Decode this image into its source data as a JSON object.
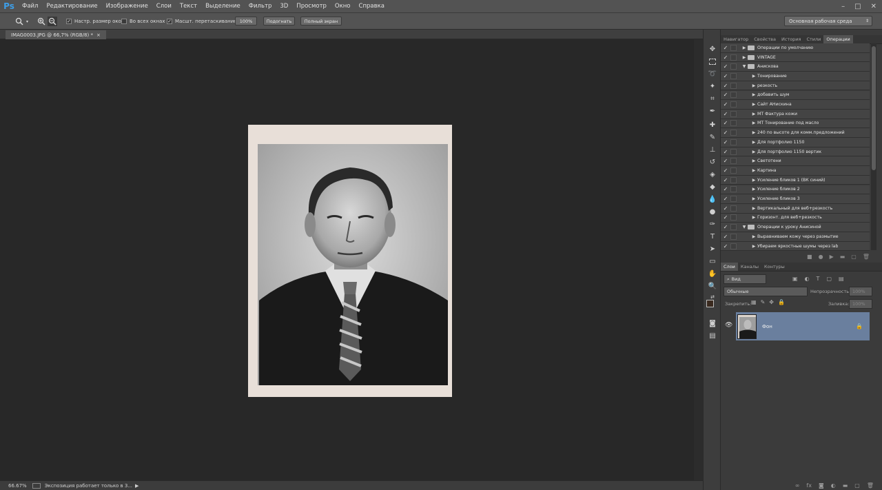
{
  "menubar": {
    "logo": "Ps",
    "items": [
      "Файл",
      "Редактирование",
      "Изображение",
      "Слои",
      "Текст",
      "Выделение",
      "Фильтр",
      "3D",
      "Просмотр",
      "Окно",
      "Справка"
    ],
    "window_controls": [
      "–",
      "□",
      "✕"
    ]
  },
  "optionsbar": {
    "resize_windows": "Настр. размер окон",
    "all_windows": "Во всех окнах",
    "scrubby_zoom": "Масшт. перетаскиванием",
    "btn_100": "100%",
    "btn_fit": "Подогнать",
    "btn_fullscreen": "Полный экран",
    "workspace": "Основная рабочая среда"
  },
  "document": {
    "tab_title": "IMAG0003.JPG @ 66,7% (RGB/8) *",
    "tab_close": "×"
  },
  "statusbar": {
    "zoom": "66.67%",
    "message": "Экспозиция работает только в 3..."
  },
  "panels": {
    "top_tabs": [
      "Навигатор",
      "Свойства",
      "История",
      "Стили",
      "Операции"
    ],
    "actions": [
      {
        "label": "Операции по умолчанию",
        "folder": true,
        "open": false
      },
      {
        "label": "VINTAGE",
        "folder": true,
        "open": false
      },
      {
        "label": "Анисковa",
        "folder": true,
        "open": true
      },
      {
        "label": "Тонирование",
        "folder": false
      },
      {
        "label": "резкость",
        "folder": false
      },
      {
        "label": "добавить шум",
        "folder": false
      },
      {
        "label": "Сайт АНискина",
        "folder": false
      },
      {
        "label": "МТ Фактура кожи",
        "folder": false
      },
      {
        "label": "МТ Тонирование под масло",
        "folder": false
      },
      {
        "label": "240 по высоте для комм.предложений",
        "folder": false
      },
      {
        "label": "Для портфолио 1150",
        "folder": false
      },
      {
        "label": "Для портфолио 1150 вертик",
        "folder": false
      },
      {
        "label": "Светотени",
        "folder": false
      },
      {
        "label": "Картина",
        "folder": false
      },
      {
        "label": "Усиление бликов 1 (ВК синий)",
        "folder": false
      },
      {
        "label": "Усиление бликов 2",
        "folder": false
      },
      {
        "label": "Усиление бликов 3",
        "folder": false
      },
      {
        "label": "Вертикальный для веб+резкость",
        "folder": false
      },
      {
        "label": "Горизонт. для веб+резкость",
        "folder": false
      },
      {
        "label": "Операции к уроку Анисиной",
        "folder": true,
        "open": true
      },
      {
        "label": "Выравниваем кожу через размытие",
        "folder": false
      },
      {
        "label": "Убираем яркостные шумы через lab",
        "folder": false
      }
    ],
    "layers_tabs": [
      "Слои",
      "Каналы",
      "Контуры"
    ],
    "layer_filter": "Вид",
    "blend_mode": "Обычные",
    "opacity_label": "Непрозрачность:",
    "opacity_value": "100%",
    "lock_label": "Закрепить:",
    "fill_label": "Заливка:",
    "fill_value": "100%",
    "layer_name": "Фон"
  }
}
